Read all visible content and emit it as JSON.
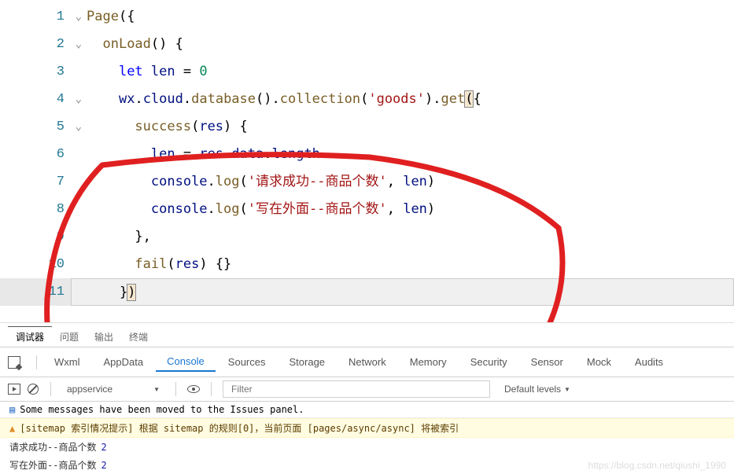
{
  "editor": {
    "lines": [
      {
        "n": 1,
        "fold": true
      },
      {
        "n": 2,
        "fold": true
      },
      {
        "n": 3
      },
      {
        "n": 4,
        "fold": true
      },
      {
        "n": 5,
        "fold": true
      },
      {
        "n": 6
      },
      {
        "n": 7
      },
      {
        "n": 8
      },
      {
        "n": 9
      },
      {
        "n": 10
      },
      {
        "n": 11,
        "selected": true
      }
    ],
    "tokens": {
      "page": "Page",
      "onLoad": "onLoad",
      "let": "let",
      "len": "len",
      "eq0": " = ",
      "zero": "0",
      "wx": "wx",
      "cloud": "cloud",
      "database": "database",
      "collection": "collection",
      "goods": "'goods'",
      "get": "get",
      "success": "success",
      "res": "res",
      "data": "data",
      "length": "length",
      "console": "console",
      "log": "log",
      "str1": "'请求成功--商品个数'",
      "str2": "'写在外面--商品个数'",
      "fail": "fail"
    }
  },
  "panel_tabs": {
    "debugger": "调试器",
    "problems": "问题",
    "output": "输出",
    "terminal": "终端"
  },
  "devtools": {
    "tabs": {
      "wxml": "Wxml",
      "appdata": "AppData",
      "console": "Console",
      "sources": "Sources",
      "storage": "Storage",
      "network": "Network",
      "memory": "Memory",
      "security": "Security",
      "sensor": "Sensor",
      "mock": "Mock",
      "audits": "Audits"
    },
    "toolbar": {
      "context": "appservice",
      "filter_placeholder": "Filter",
      "levels": "Default levels"
    },
    "messages": {
      "issues": "Some messages have been moved to the Issues panel.",
      "sitemap": "[sitemap 索引情况提示] 根据 sitemap 的规则[0]，当前页面 [pages/async/async] 将被索引",
      "log1_text": "请求成功--商品个数",
      "log1_val": "2",
      "log2_text": "写在外面--商品个数",
      "log2_val": "2"
    }
  },
  "watermark": "https://blog.csdn.net/qiushi_1990"
}
